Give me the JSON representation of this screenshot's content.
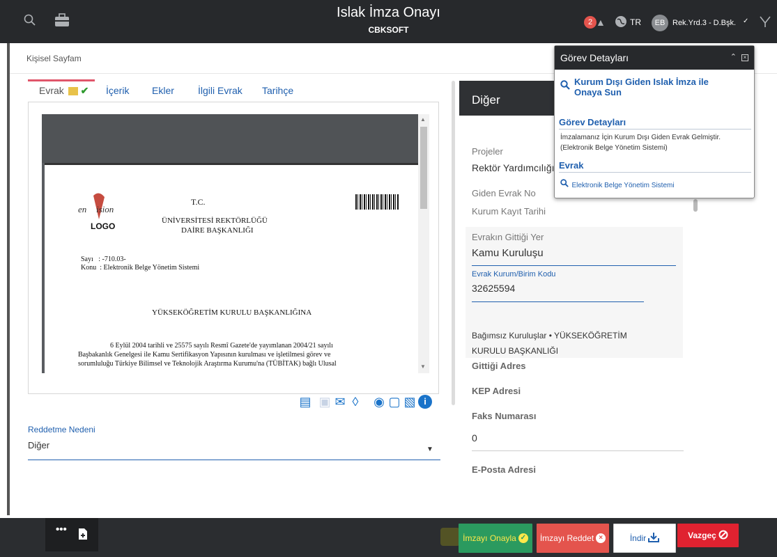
{
  "header": {
    "title": "Islak İmza Onayı",
    "subtitle": "CBKSOFT",
    "notification_count": "2",
    "language": "TR",
    "user_initials": "EB",
    "user_name": "Rek.Yrd.3 - D.Bşk."
  },
  "breadcrumb": "Kişisel Sayfam",
  "tabs": [
    {
      "label": "Evrak",
      "active": true
    },
    {
      "label": "İçerik"
    },
    {
      "label": "Ekler"
    },
    {
      "label": "İlgili Evrak"
    },
    {
      "label": "Tarihçe"
    }
  ],
  "document": {
    "logo_top": "envision",
    "logo_bottom": "LOGO",
    "tc": "T.C.",
    "university": "ÜNİVERSİTESİ REKTÖRLÜĞÜ",
    "department": "DAİRE BAŞKANLIĞI",
    "sayi": "Sayı   : -710.03-",
    "konu": "Konu  : Elektronik Belge Yönetim Sistemi",
    "recipient": "YÜKSEKÖĞRETİM KURULU BAŞKANLIĞINA",
    "body_line1": "6 Eylül 2004 tarihli ve 25575 sayılı Resmî Gazete'de yayımlanan 2004/21 sayılı",
    "body_line2": "Başbakanlık Genelgesi ile Kamu Sertifikasyon Yapısının kurulması ve işletilmesi görev ve",
    "body_line3": "sorumluluğu Türkiye Bilimsel ve Teknolojik Araştırma Kurumu'na (TÜBİTAK) bağlı Ulusal"
  },
  "reject_reason": {
    "label": "Reddetme Nedeni",
    "value": "Diğer"
  },
  "right_panel": {
    "header": "Diğer",
    "projeler_label": "Projeler",
    "projeler_value": "Rektör Yardımcılığı",
    "giden_evrak_no_label": "Giden Evrak No",
    "kurum_kayit_tarihi_label": "Kurum Kayıt Tarihi",
    "evrakin_gittigi_yer_label": "Evrakın Gittiği Yer",
    "evrakin_gittigi_yer_value": "Kamu Kuruluşu",
    "kurum_kodu_label": "Evrak Kurum/Birim Kodu",
    "kurum_kodu_value": "32625594",
    "kurum_line1": "Bağımsız Kuruluşlar • YÜKSEKÖĞRETİM",
    "kurum_line2": "KURULU BAŞKANLIĞI",
    "gittigi_adres_label": "Gittiği Adres",
    "kep_label": "KEP Adresi",
    "faks_label": "Faks Numarası",
    "faks_value": "0",
    "eposta_label": "E-Posta Adresi"
  },
  "popup": {
    "title": "Görev Detayları",
    "task_link_line1": "Kurum Dışı Giden Islak İmza ile",
    "task_link_line2": "Onaya Sun",
    "section1": "Görev Detayları",
    "desc_line1": "İmzalamanız İçin Kurum Dışı Giden Evrak Gelmiştir.",
    "desc_line2": "(Elektronik Belge Yönetim Sistemi)",
    "section2": "Evrak",
    "evrak_link": "Elektronik Belge Yönetim Sistemi"
  },
  "actions": {
    "approve": "İmzayı Onayla",
    "reject": "İmzayı Reddet",
    "download": "İndir",
    "cancel": "Vazgeç"
  },
  "colors": {
    "topbar": "#27292c",
    "link": "#1f5fae",
    "approve": "#2b9a5f",
    "reject": "#e4544d",
    "cancel": "#e02230"
  }
}
